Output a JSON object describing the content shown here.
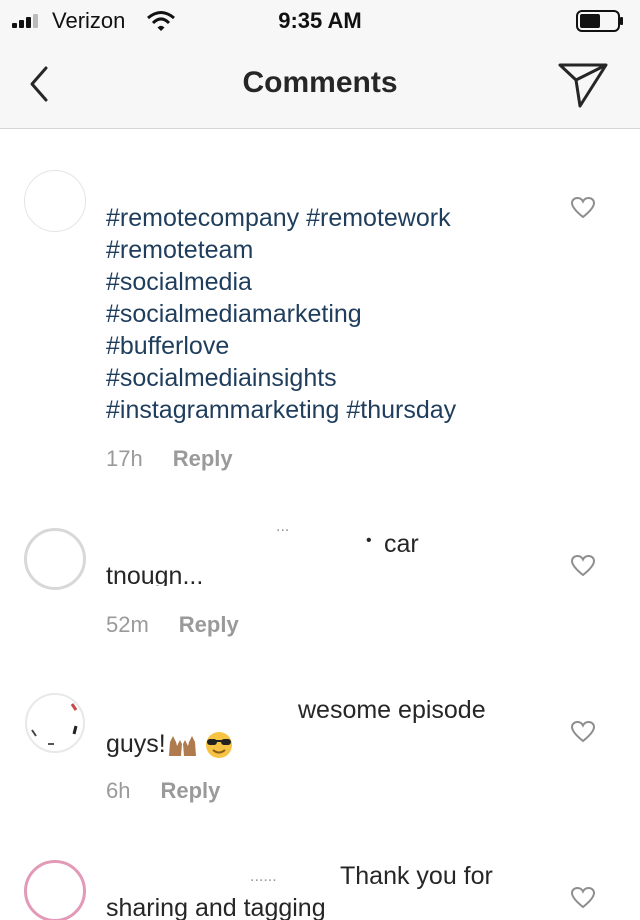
{
  "status_bar": {
    "carrier": "Verizon",
    "time": "9:35 AM"
  },
  "nav": {
    "title": "Comments"
  },
  "comments": [
    {
      "hashtags": [
        "#remotecompany #remotework",
        "#remoteteam",
        "#socialmedia",
        "#socialmediamarketing",
        "#bufferlove",
        "#socialmediainsights",
        "#instagrammarketing #thursday"
      ],
      "time": "17h",
      "reply": "Reply"
    },
    {
      "line1": "car",
      "line2": "tnougn...",
      "time": "52m",
      "reply": "Reply"
    },
    {
      "line1": "wesome episode",
      "line2": "guys!",
      "emojis": [
        "raised-hands-emoji",
        "sunglasses-emoji"
      ],
      "time": "6h",
      "reply": "Reply"
    },
    {
      "line1": "Thank you for",
      "line2": "sharing and tagging"
    }
  ],
  "colors": {
    "hashtag": "#1f3d5c",
    "meta": "#9a9a9a",
    "bar_bg": "#f7f7f7",
    "avatar_ring_pink": "#e39ab8"
  }
}
